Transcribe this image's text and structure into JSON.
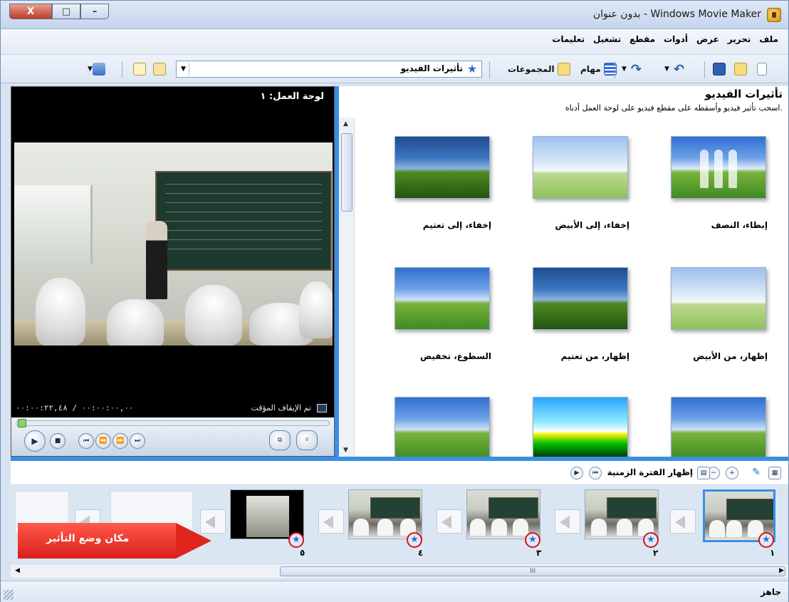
{
  "window": {
    "title": "بدون عنوان - Windows Movie Maker",
    "close_label": "X",
    "max_label": "□",
    "min_label": "–"
  },
  "menu": {
    "items": [
      "ملف",
      "تحرير",
      "عرض",
      "أدوات",
      "مقطع",
      "تشغيل",
      "تعليمات"
    ]
  },
  "toolbar": {
    "tasks_label": "مهام",
    "collections_label": "المجموعات",
    "dropdown_value": "تأثيرات الفيديو"
  },
  "player": {
    "title": "لوحة العمل: ١",
    "status": "تم الإيقاف المؤقت",
    "timecode": "٠٠:٠٠:٠٠,٠٠ / ٠٠:٠٠:٢٢,٤٨"
  },
  "effects": {
    "title": "تأثيرات الفيديو",
    "subtitle": "اسحب تأثير فيديو وأسقطه على مقطع فيديو على لوحة العمل أدناه.",
    "items": [
      {
        "label": "إبطاء، النصف",
        "style": "ghost"
      },
      {
        "label": "إخفاء، إلى الأبيض",
        "style": "white"
      },
      {
        "label": "إخفاء، إلى تعتيم",
        "style": "dark"
      },
      {
        "label": "إظهار، من الأبيض",
        "style": "white"
      },
      {
        "label": "إظهار، من تعتيم",
        "style": "dark"
      },
      {
        "label": "السطوع، تخفيض",
        "style": "normal"
      },
      {
        "label": "",
        "style": "normal"
      },
      {
        "label": "",
        "style": "neon"
      },
      {
        "label": "",
        "style": "normal"
      }
    ]
  },
  "storyboard": {
    "show_timeline_label": "إظهار الفترة الزمنية",
    "clip_numbers": [
      "١",
      "٢",
      "٣",
      "٤",
      "٥"
    ],
    "callout": "مكان وضع التأثير"
  },
  "scrollbar": {
    "thumb_label": "III"
  },
  "status": {
    "text": "جاهز"
  },
  "colors": {
    "accent_blue": "#3a8ee6",
    "highlight_red": "#d4141b"
  },
  "icons": {
    "effect_star": "★",
    "play": "▶",
    "stop": "■",
    "prev": "⏮",
    "rewind": "⏪",
    "forward": "⏩",
    "next": "⏭",
    "split": "⧉",
    "snapshot": "⌾"
  }
}
